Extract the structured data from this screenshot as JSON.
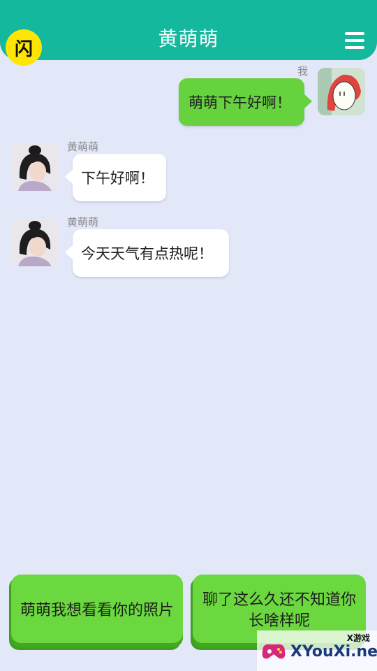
{
  "header": {
    "title": "黄萌萌",
    "logo_glyph": "闪"
  },
  "messages": [
    {
      "sender": "我",
      "text": "萌萌下午好啊！",
      "side": "right"
    },
    {
      "sender": "黄萌萌",
      "text": "下午好啊！",
      "side": "left"
    },
    {
      "sender": "黄萌萌",
      "text": "今天天气有点热呢！",
      "side": "left"
    }
  ],
  "choices": [
    {
      "text": "萌萌我想看看你的照片"
    },
    {
      "line1": "聊了这么久还不知道你",
      "line2": "长啥样呢"
    }
  ],
  "watermark": {
    "top": "X游戏",
    "brand": "XYouXi.net"
  },
  "colors": {
    "header": "#13b89d",
    "background": "#e3e8f9",
    "my_bubble": "#66d23d",
    "choice": "#6bd840"
  }
}
